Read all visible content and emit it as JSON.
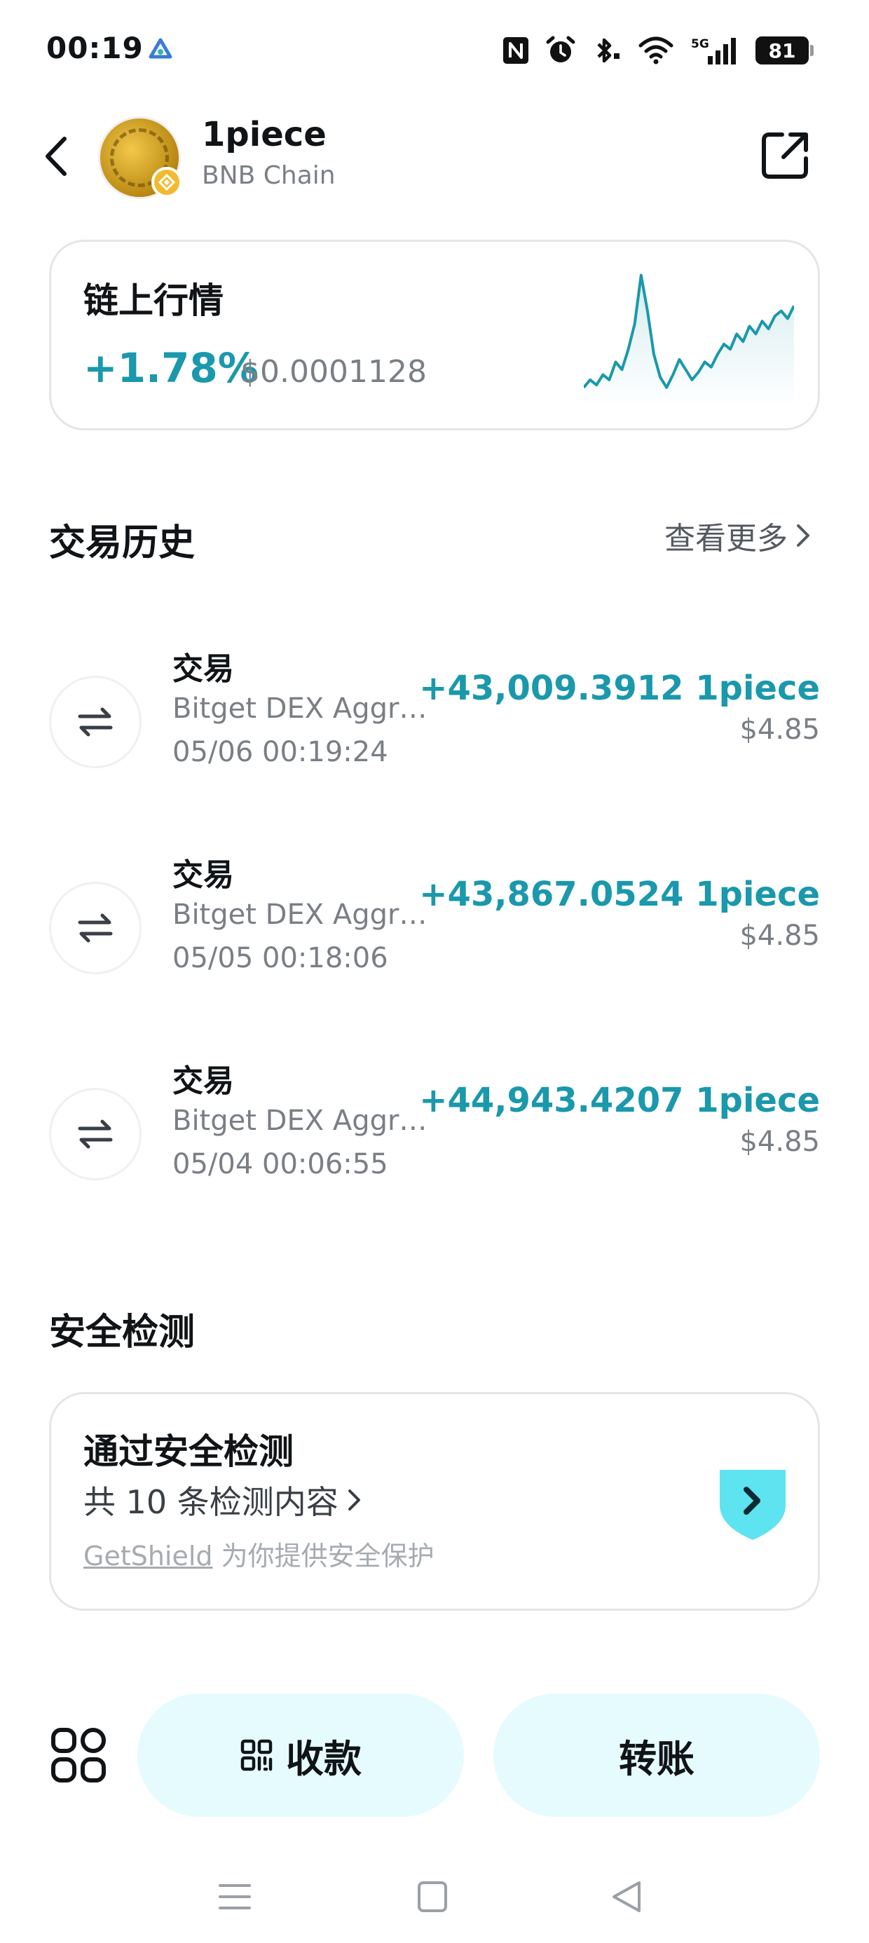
{
  "status_bar": {
    "time": "00:19",
    "battery": "81",
    "icons": [
      "nfc-icon",
      "alarm-icon",
      "bluetooth-icon",
      "wifi-icon",
      "5g-signal-icon",
      "battery-icon"
    ]
  },
  "header": {
    "token_name": "1piece",
    "chain_name": "BNB Chain"
  },
  "market": {
    "title": "链上行情",
    "change": "+1.78%",
    "price": "$0.0001128",
    "sparkline": [
      0.1,
      0.16,
      0.12,
      0.2,
      0.16,
      0.3,
      0.24,
      0.4,
      0.6,
      0.98,
      0.7,
      0.36,
      0.18,
      0.1,
      0.2,
      0.32,
      0.24,
      0.16,
      0.22,
      0.3,
      0.26,
      0.36,
      0.44,
      0.4,
      0.52,
      0.46,
      0.58,
      0.52,
      0.62,
      0.56,
      0.66,
      0.7,
      0.64,
      0.74
    ],
    "accent_color": "#1a98ac"
  },
  "history": {
    "title": "交易历史",
    "view_more": "查看更多",
    "items": [
      {
        "type": "交易",
        "desc": "Bitget DEX Aggr…",
        "time": "05/06 00:19:24",
        "amount": "+43,009.3912 1piece",
        "usd": "$4.85"
      },
      {
        "type": "交易",
        "desc": "Bitget DEX Aggr…",
        "time": "05/05 00:18:06",
        "amount": "+43,867.0524 1piece",
        "usd": "$4.85"
      },
      {
        "type": "交易",
        "desc": "Bitget DEX Aggr…",
        "time": "05/04 00:06:55",
        "amount": "+44,943.4207 1piece",
        "usd": "$4.85"
      }
    ]
  },
  "security": {
    "section_title": "安全检测",
    "title": "通过安全检测",
    "count": "共 10 条检测内容",
    "provider_brand": "GetShield",
    "provider_text": " 为你提供安全保护",
    "shield_color": "#5ee3f0"
  },
  "actions": {
    "receive": "收款",
    "transfer": "转账",
    "button_bg": "#e6fbfd"
  }
}
